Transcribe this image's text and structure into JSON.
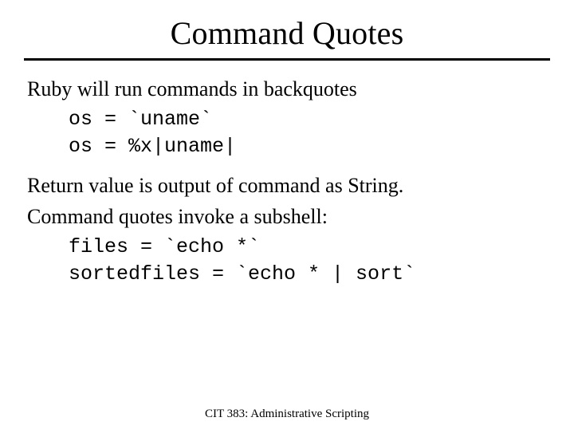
{
  "title": "Command Quotes",
  "p1": "Ruby will run commands in backquotes",
  "code1_line1": "os = `uname`",
  "code1_line2": "os = %x|uname|",
  "p2": "Return value is output of command as String.",
  "p3": "Command quotes invoke a subshell:",
  "code2_line1": "files = `echo *`",
  "code2_line2": "sortedfiles = `echo * | sort`",
  "footer": "CIT 383: Administrative Scripting"
}
